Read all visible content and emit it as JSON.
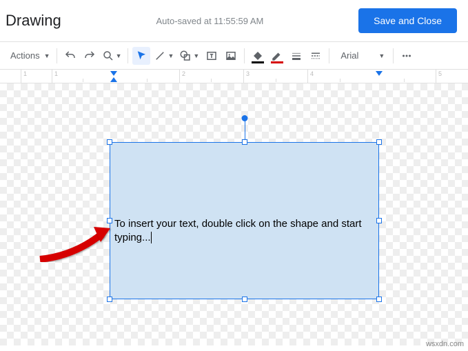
{
  "header": {
    "title": "Drawing",
    "autosave": "Auto-saved at 11:55:59 AM",
    "save_btn": "Save and Close"
  },
  "toolbar": {
    "actions": "Actions",
    "font": "Arial"
  },
  "ruler": {
    "labels": [
      "1",
      "1",
      "2",
      "3",
      "4",
      "5"
    ]
  },
  "shape": {
    "text": "To insert your text, double click on the shape and start typing..."
  },
  "watermark": "wsxdn.com",
  "colors": {
    "accent": "#1a73e8",
    "shape_fill": "#cfe2f3",
    "arrow": "#d60000"
  }
}
